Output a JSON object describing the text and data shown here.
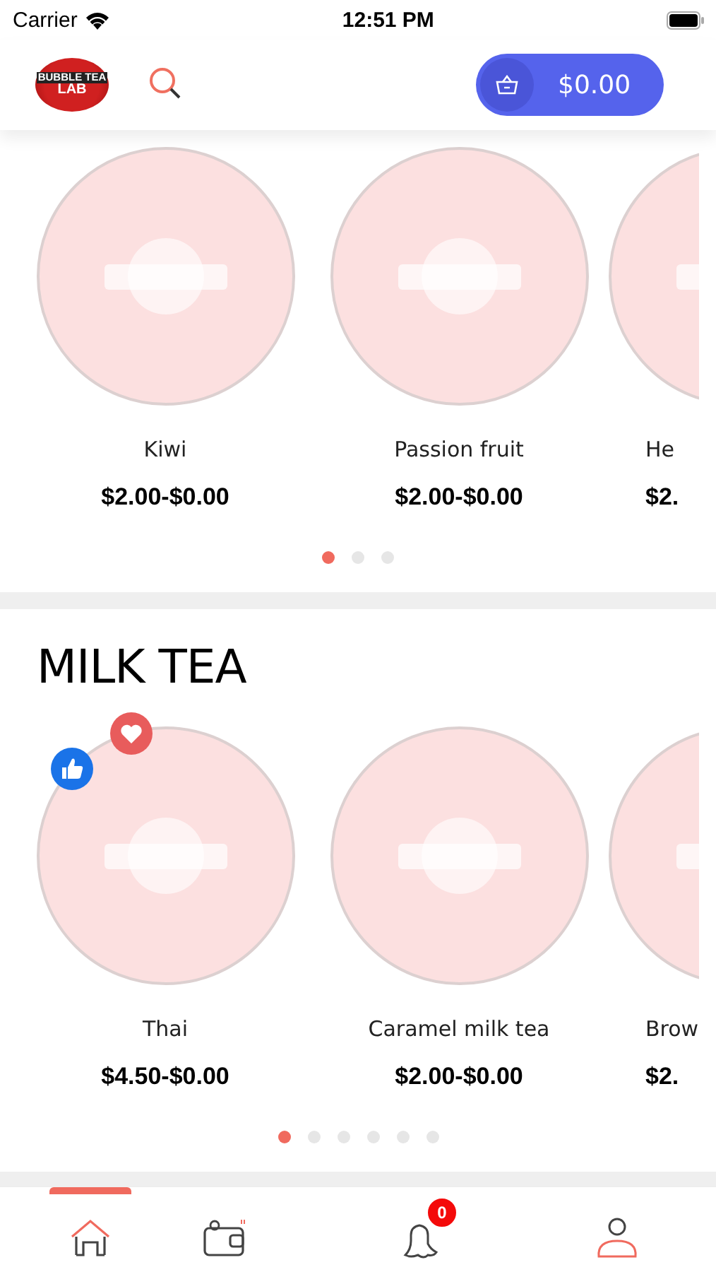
{
  "status_bar": {
    "carrier": "Carrier",
    "time": "12:51 PM"
  },
  "header": {
    "logo": {
      "line1": "BUBBLE TEA",
      "line2": "LAB"
    },
    "cart_total": "$0.00"
  },
  "sections": [
    {
      "items": [
        {
          "kind": "full",
          "name": "Kiwi",
          "price": "$2.00-$0.00",
          "liked": false,
          "favorite": false
        },
        {
          "kind": "full",
          "name": "Passion fruit",
          "price": "$2.00-$0.00",
          "liked": false,
          "favorite": false
        },
        {
          "kind": "partial",
          "name": "He",
          "price": "$2.",
          "liked": false,
          "favorite": false
        }
      ],
      "pages": [
        {
          "selected": true
        },
        {
          "selected": false
        },
        {
          "selected": false
        }
      ]
    },
    {
      "title": "MILK TEA",
      "items": [
        {
          "kind": "full",
          "name": "Thai",
          "price": "$4.50-$0.00",
          "liked": true,
          "favorite": true
        },
        {
          "kind": "full",
          "name": "Caramel milk tea",
          "price": "$2.00-$0.00",
          "liked": false,
          "favorite": false
        },
        {
          "kind": "partial",
          "name": "Brow",
          "price": "$2.",
          "liked": false,
          "favorite": false
        }
      ],
      "pages": [
        {
          "selected": true
        },
        {
          "selected": false
        },
        {
          "selected": false
        },
        {
          "selected": false
        },
        {
          "selected": false
        },
        {
          "selected": false
        }
      ]
    }
  ],
  "tab_bar": {
    "tabs": [
      {
        "kind": "home",
        "selected": true
      },
      {
        "kind": "wallet",
        "selected": false
      },
      {
        "kind": "notifications",
        "selected": false,
        "badge": "0"
      },
      {
        "kind": "profile",
        "selected": false
      }
    ]
  }
}
